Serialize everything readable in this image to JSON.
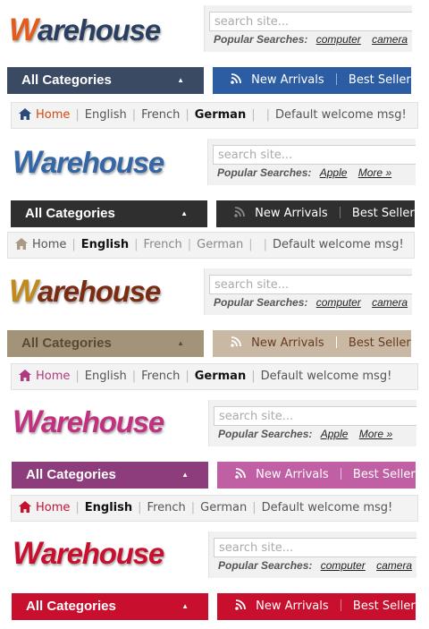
{
  "variants": [
    {
      "logo": {
        "first": "W",
        "rest": "arehouse",
        "first_color": "#e45c1c",
        "rest_color": "#2a3f60"
      },
      "search": {
        "placeholder": "search site...",
        "popular_label": "Popular Searches:",
        "keywords": [
          "computer",
          "camera"
        ]
      },
      "categories": {
        "label": "All Categories",
        "color": "#3a4a63"
      },
      "nav": {
        "items": [
          "New Arrivals",
          "Best Sellers"
        ],
        "color": "#2c5da3"
      },
      "topbar": {
        "home": "Home",
        "langs": [
          "English",
          "French",
          "German"
        ],
        "active": "German",
        "welcome": "Default welcome msg!",
        "accent": "#d8460f"
      }
    },
    {
      "logo": {
        "first": "W",
        "rest": "arehouse",
        "first_color": "#3567a6",
        "rest_color": "#3567a6"
      },
      "search": {
        "placeholder": "search site...",
        "popular_label": "Popular Searches:",
        "keywords": [
          "Apple",
          "More »"
        ]
      },
      "categories": {
        "label": "All Categories",
        "color": "#2f2f2f"
      },
      "nav": {
        "items": [
          "New Arrivals",
          "Best Sellers"
        ],
        "color": "#2f2f2f"
      },
      "topbar": {
        "home": "Home",
        "langs": [
          "English",
          "French",
          "German"
        ],
        "active": "English",
        "welcome": "Default welcome msg!",
        "accent": "#9a8b75"
      }
    },
    {
      "logo": {
        "first": "W",
        "rest": "arehouse",
        "first_color": "#c08a1c",
        "rest_color": "#7a2b12"
      },
      "search": {
        "placeholder": "search site...",
        "popular_label": "Popular Searches:",
        "keywords": [
          "computer",
          "camera"
        ]
      },
      "categories": {
        "label": "All Categories",
        "color": "#a39479"
      },
      "nav": {
        "items": [
          "New Arrivals",
          "Best Sellers"
        ],
        "color": "#c9b8a4"
      },
      "topbar": {
        "home": "Home",
        "langs": [
          "English",
          "French",
          "German"
        ],
        "active": "German",
        "welcome": "Default welcome msg!",
        "accent": "#b03a7e"
      }
    },
    {
      "logo": {
        "first": "W",
        "rest": "arehouse",
        "first_color": "#c2317f",
        "rest_color": "#c2317f"
      },
      "search": {
        "placeholder": "search site...",
        "popular_label": "Popular Searches:",
        "keywords": [
          "Apple",
          "More »"
        ]
      },
      "categories": {
        "label": "All Categories",
        "color": "#8e3d7c"
      },
      "nav": {
        "items": [
          "New Arrivals",
          "Best Sellers"
        ],
        "color": "#c05fa3"
      },
      "topbar": {
        "home": "Home",
        "langs": [
          "English",
          "French",
          "German"
        ],
        "active": "English",
        "welcome": "Default welcome msg!",
        "accent": "#c8102e"
      }
    },
    {
      "logo": {
        "first": "W",
        "rest": "arehouse",
        "first_color": "#c8102e",
        "rest_color": "#c8102e"
      },
      "search": {
        "placeholder": "search site...",
        "popular_label": "Popular Searches:",
        "keywords": [
          "computer",
          "camera"
        ]
      },
      "categories": {
        "label": "All Categories",
        "color": "#c8102e"
      },
      "nav": {
        "items": [
          "New Arrivals",
          "Best Sellers"
        ],
        "color": "#c8102e"
      }
    }
  ]
}
